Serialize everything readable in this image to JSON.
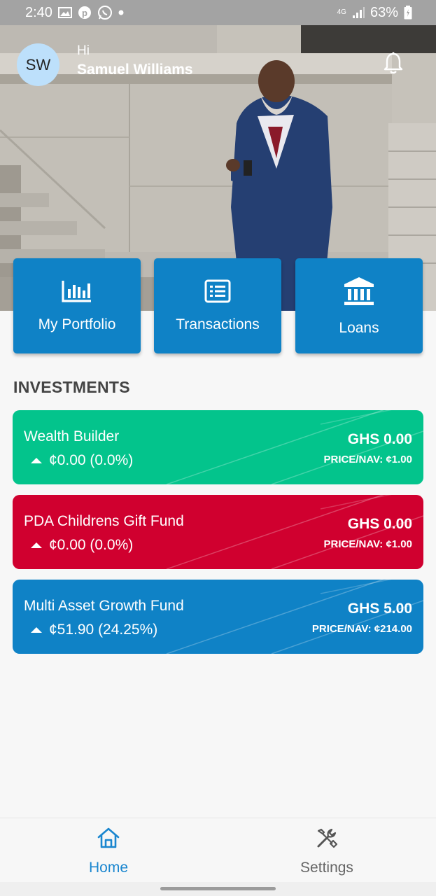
{
  "status_bar": {
    "time": "2:40",
    "battery": "63%",
    "network": "4G"
  },
  "header": {
    "avatar_initials": "SW",
    "greeting": "Hi",
    "user_name": "Samuel Williams"
  },
  "quick_actions": [
    {
      "label": "My Portfolio",
      "icon": "bar-chart-icon"
    },
    {
      "label": "Transactions",
      "icon": "list-icon"
    },
    {
      "label": "Loans",
      "icon": "bank-icon"
    }
  ],
  "investments": {
    "title": "INVESTMENTS",
    "items": [
      {
        "name": "Wealth Builder",
        "change": "¢0.00 (0.0%)",
        "amount": "GHS 0.00",
        "price_nav": "PRICE/NAV: ¢1.00",
        "color": "#03c48c"
      },
      {
        "name": "PDA Childrens Gift Fund",
        "change": "¢0.00 (0.0%)",
        "amount": "GHS 0.00",
        "price_nav": "PRICE/NAV: ¢1.00",
        "color": "#d0002f"
      },
      {
        "name": "Multi Asset Growth Fund",
        "change": "¢51.90 (24.25%)",
        "amount": "GHS 5.00",
        "price_nav": "PRICE/NAV: ¢214.00",
        "color": "#0f82c6"
      }
    ]
  },
  "bottom_nav": {
    "items": [
      {
        "label": "Home",
        "icon": "home-icon",
        "active": true
      },
      {
        "label": "Settings",
        "icon": "tools-icon",
        "active": false
      }
    ]
  },
  "colors": {
    "primary": "#0f82c6",
    "active_nav": "#1a86cf",
    "inactive_nav": "#666666"
  }
}
